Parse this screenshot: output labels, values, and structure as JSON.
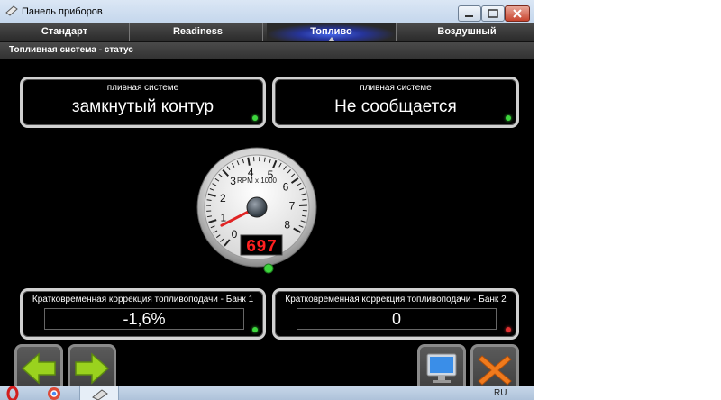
{
  "window": {
    "title": "Панель приборов"
  },
  "tabs": [
    {
      "label": "Стандарт",
      "active": false
    },
    {
      "label": "Readiness",
      "active": false
    },
    {
      "label": "Топливо",
      "active": true
    },
    {
      "label": "Воздушный",
      "active": false
    }
  ],
  "section": {
    "title": "Топливная система - статус"
  },
  "panels": {
    "fuel_system_1": {
      "label": "пливная системе",
      "value": "замкнутый контур",
      "status_color": "#3dd63d"
    },
    "fuel_system_2": {
      "label": "пливная системе",
      "value": "Не сообщается",
      "status_color": "#3dd63d"
    },
    "fuel_trim_1": {
      "label": "Кратковременная коррекция топливоподачи - Банк 1",
      "value": "-1,6%",
      "status_color": "#3dd63d"
    },
    "fuel_trim_2": {
      "label": "Кратковременная коррекция топливоподачи - Банк 2",
      "value": "0",
      "status_color": "#e03030"
    }
  },
  "gauge": {
    "unit_label": "RPM x 1000",
    "ticks": [
      "0",
      "1",
      "2",
      "3",
      "4",
      "5",
      "6",
      "7",
      "8"
    ],
    "min": 0,
    "max": 8,
    "needle_value": 0.697,
    "digital_readout": "697"
  },
  "nav": {
    "back_icon": "arrow-left-icon",
    "forward_icon": "arrow-right-icon",
    "display_icon": "monitor-icon",
    "close_icon": "close-x-icon"
  },
  "taskbar": {
    "language": "RU"
  },
  "colors": {
    "accent_tab": "#3a4fd0",
    "arrow": "#9ad21e",
    "close_x": "#f07a1c",
    "digital": "#ff2020"
  }
}
